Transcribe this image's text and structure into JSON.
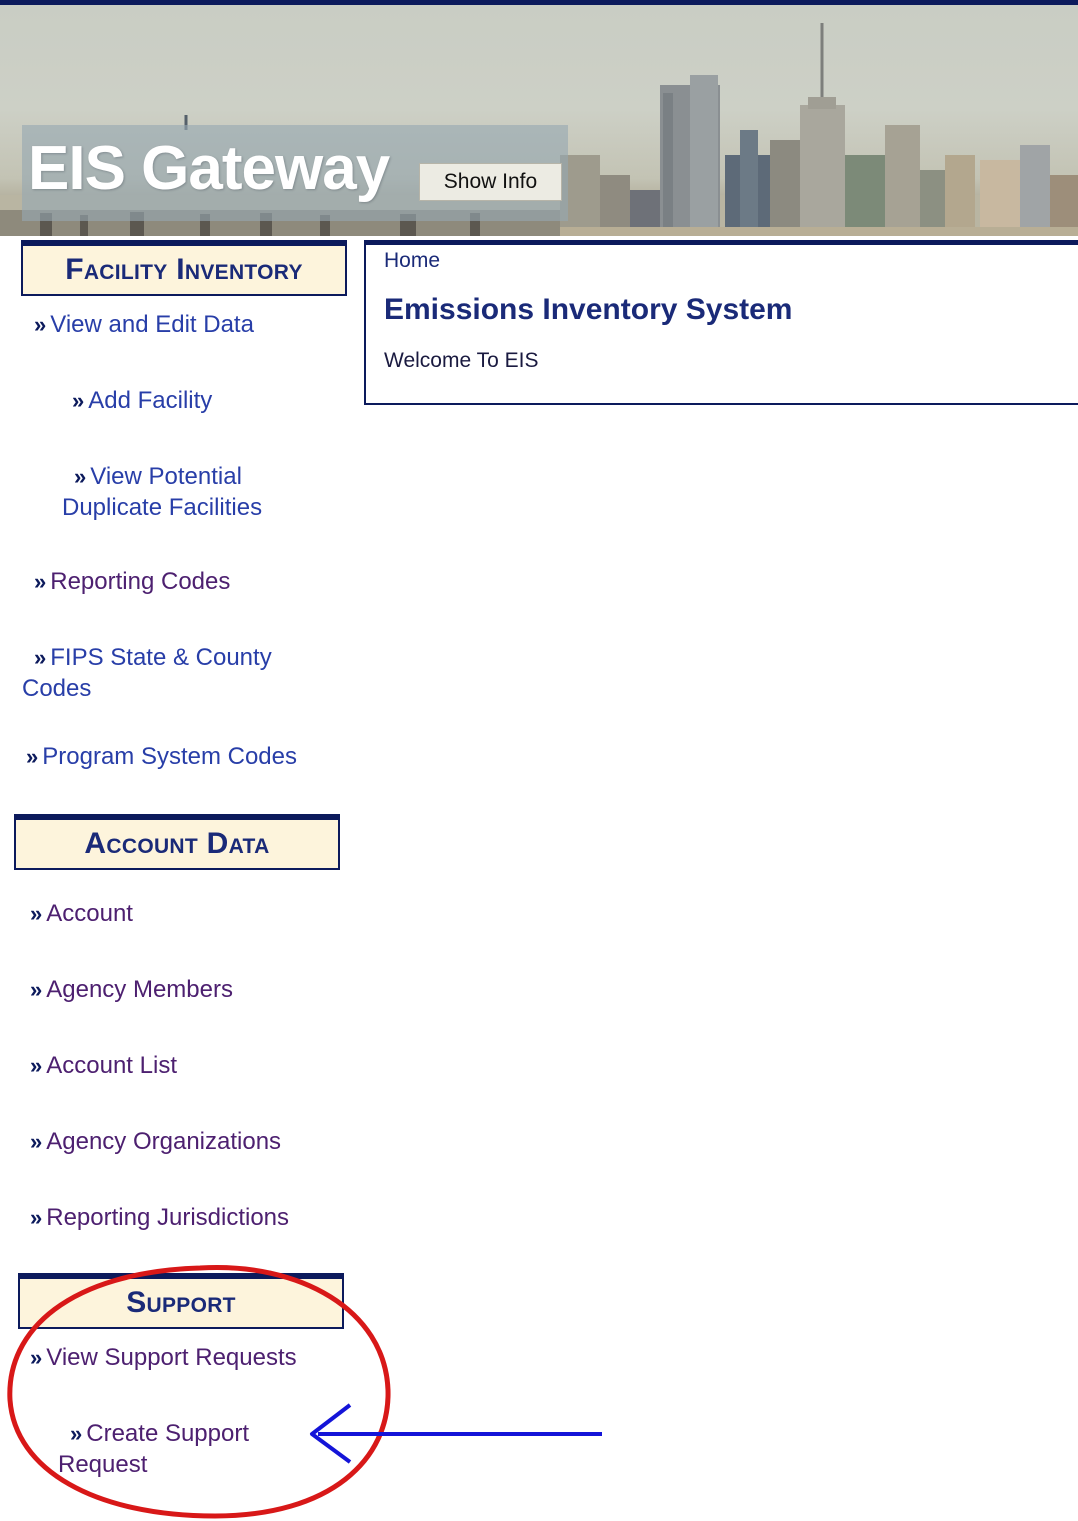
{
  "header": {
    "site_title": "EIS Gateway",
    "show_info_label": "Show Info"
  },
  "sidebar": {
    "facility_inventory": {
      "title": "Facility Inventory",
      "links": [
        {
          "label": "View and Edit Data"
        },
        {
          "label": "Add Facility"
        },
        {
          "label_line1": "View Potential",
          "label_line2": "Duplicate Facilities"
        },
        {
          "label": "Reporting Codes"
        },
        {
          "label_line1": "FIPS State & County",
          "label_line2": "Codes"
        },
        {
          "label": "Program System Codes"
        }
      ]
    },
    "account_data": {
      "title": "Account Data",
      "links": [
        {
          "label": "Account"
        },
        {
          "label": "Agency Members"
        },
        {
          "label": "Account List"
        },
        {
          "label": "Agency Organizations"
        },
        {
          "label": "Reporting Jurisdictions"
        }
      ]
    },
    "support": {
      "title": "Support",
      "links": [
        {
          "label": "View Support Requests"
        },
        {
          "label_line1": "Create Support",
          "label_line2": "Request"
        }
      ]
    }
  },
  "main": {
    "breadcrumb": "Home",
    "page_title": "Emissions Inventory System",
    "welcome_text": "Welcome To EIS"
  },
  "colors": {
    "navy": "#0c1a5c",
    "header_bg": "#fdf4dc",
    "link": "#283ea8",
    "visited_link": "#4d2070",
    "annotation_circle": "#d81818",
    "annotation_arrow": "#1414d8"
  },
  "icons": {
    "link_bullet": "double-chevron-right-icon",
    "annotation_arrow": "arrow-left-icon"
  }
}
